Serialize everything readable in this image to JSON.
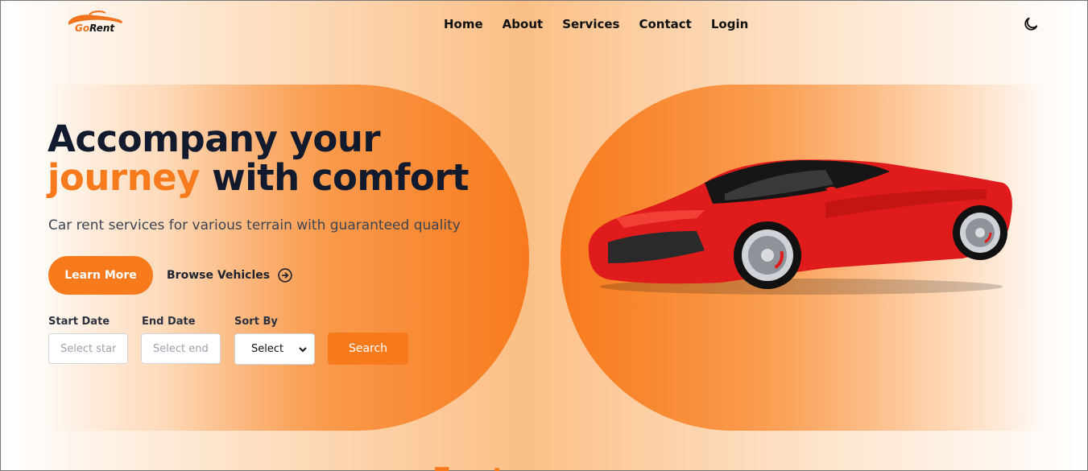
{
  "brand": {
    "logo_text_a": "Go",
    "logo_text_b": "Rent",
    "accent_color": "#f77a1c"
  },
  "nav": {
    "items": [
      "Home",
      "About",
      "Services",
      "Contact",
      "Login"
    ],
    "theme_icon": "moon-icon"
  },
  "hero": {
    "headline_line1": "Accompany your",
    "headline_accent": "journey",
    "headline_rest": " with comfort",
    "subtitle": "Car rent services for various terrain with guaranteed quality",
    "learn_more": "Learn More",
    "browse": "Browse Vehicles",
    "browse_icon": "arrow-right-circle-icon"
  },
  "search": {
    "start_label": "Start Date",
    "start_placeholder": "Select start date",
    "end_label": "End Date",
    "end_placeholder": "Select end date",
    "sort_label": "Sort By",
    "sort_value": "Select",
    "button": "Search"
  },
  "featured": {
    "peek": "Featured"
  }
}
